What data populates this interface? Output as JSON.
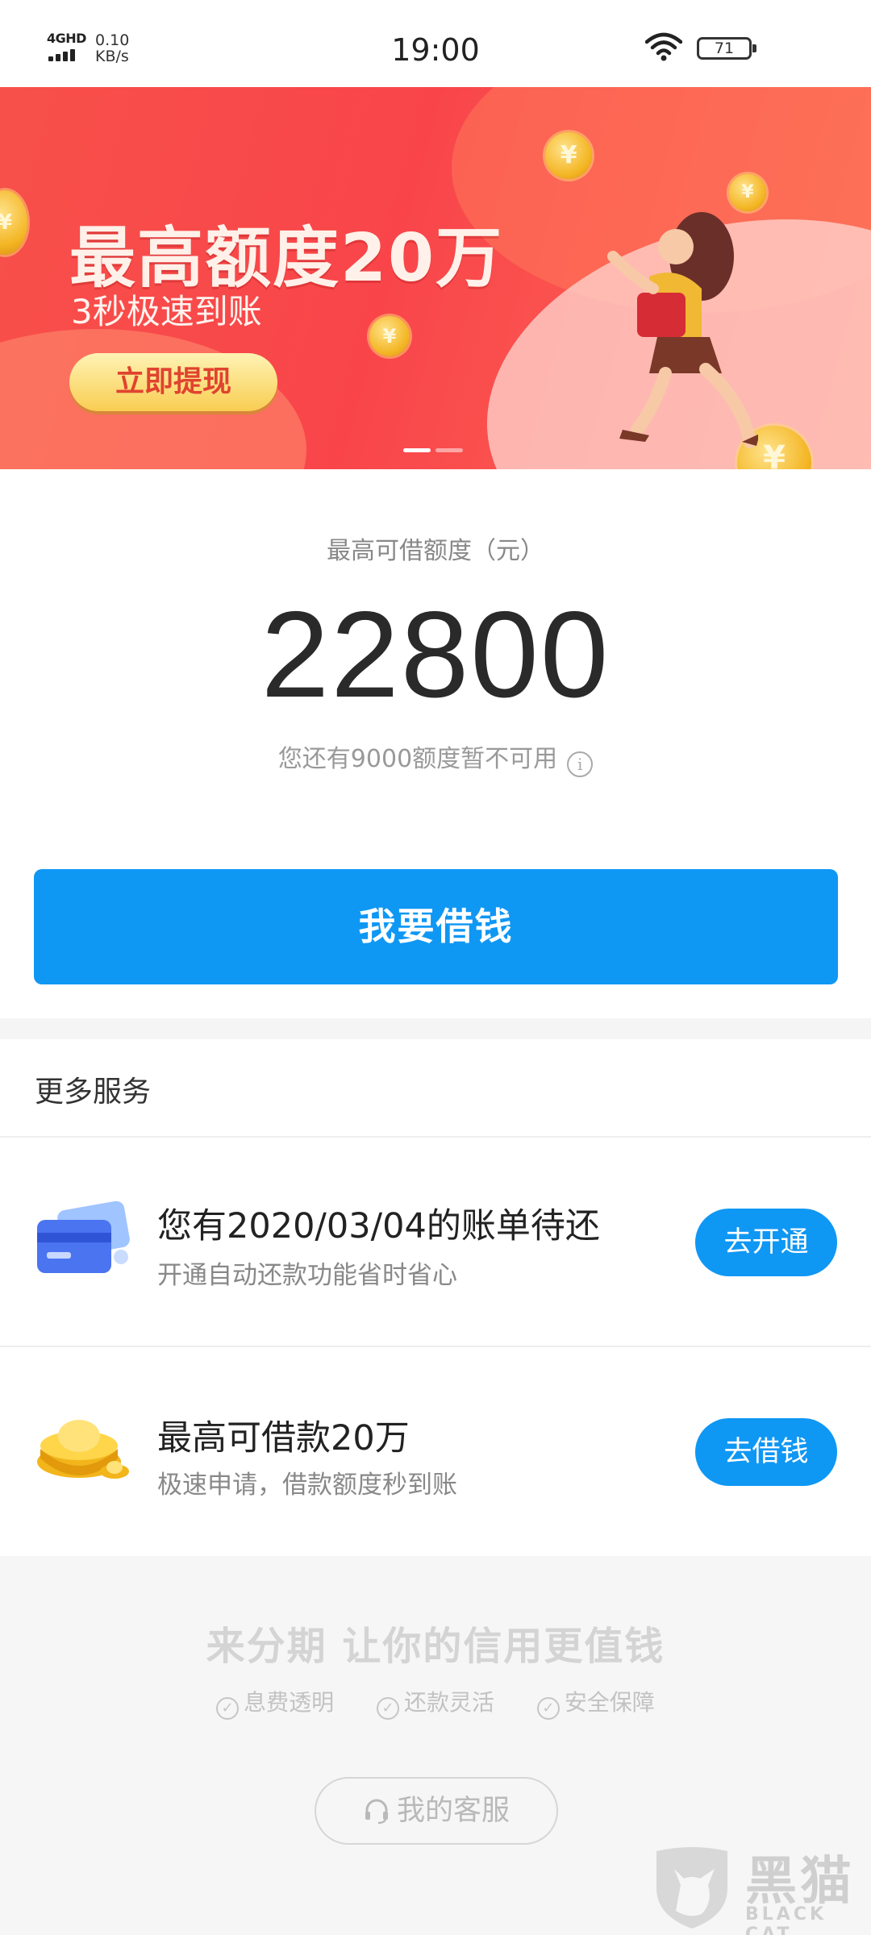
{
  "status_bar": {
    "network": "4GHD",
    "speed_value": "0.10",
    "speed_unit": "KB/s",
    "time": "19:00",
    "battery": "71"
  },
  "banner": {
    "title": "最高额度20万",
    "subtitle": "3秒极速到账",
    "button": "立即提现",
    "slide_index": 1,
    "slide_count": 2
  },
  "credit": {
    "label": "最高可借额度（元）",
    "amount": "22800",
    "note": "您还有9000额度暂不可用",
    "borrow_button": "我要借钱"
  },
  "services": {
    "title": "更多服务",
    "items": [
      {
        "icon": "credit-card-icon",
        "title": "您有2020/03/04的账单待还",
        "subtitle": "开通自动还款功能省时省心",
        "button": "去开通"
      },
      {
        "icon": "gold-ingot-icon",
        "title": "最高可借款20万",
        "subtitle": "极速申请，借款额度秒到账",
        "button": "去借钱"
      }
    ]
  },
  "footer": {
    "slogan": "来分期  让你的信用更值钱",
    "features": [
      "息费透明",
      "还款灵活",
      "安全保障"
    ],
    "customer_service": "我的客服"
  },
  "watermark": {
    "name": "黑猫",
    "sub": "BLACK CAT"
  },
  "colors": {
    "primary_blue": "#0f97f4",
    "banner_red": "#f9454a"
  }
}
